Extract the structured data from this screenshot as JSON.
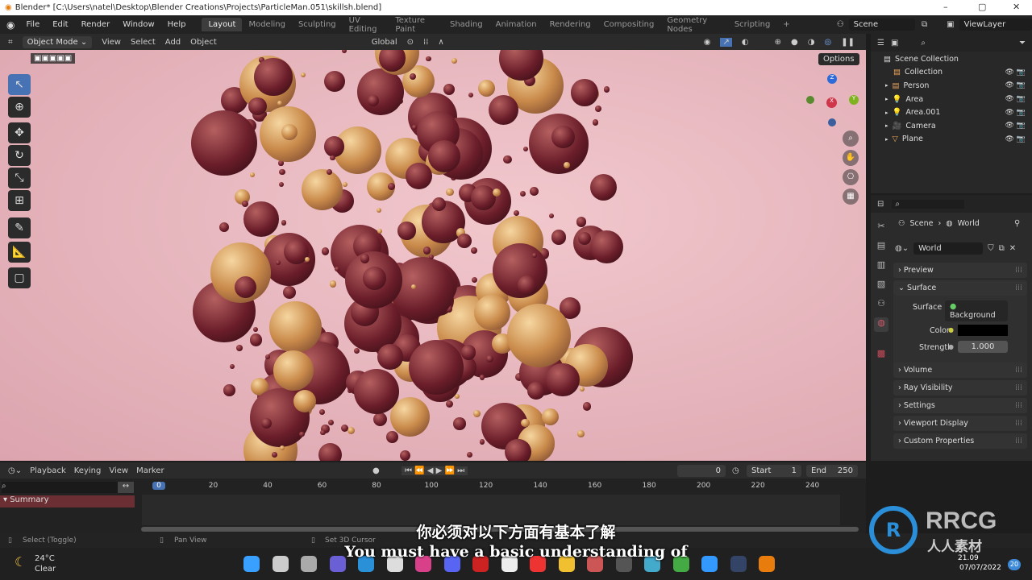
{
  "window": {
    "title": "Blender* [C:\\Users\\natel\\Desktop\\Blender Creations\\Projects\\ParticleMan.051\\skillsh.blend]",
    "minimize": "–",
    "maximize": "▢",
    "close": "✕"
  },
  "menus": [
    "File",
    "Edit",
    "Render",
    "Window",
    "Help"
  ],
  "workspaces": [
    "Layout",
    "Modeling",
    "Sculpting",
    "UV Editing",
    "Texture Paint",
    "Shading",
    "Animation",
    "Rendering",
    "Compositing",
    "Geometry Nodes",
    "Scripting",
    "+"
  ],
  "active_workspace": "Layout",
  "scene": {
    "name": "Scene",
    "view_layer": "ViewLayer"
  },
  "viewport_header": {
    "mode": "Object Mode",
    "menus": [
      "View",
      "Select",
      "Add",
      "Object"
    ],
    "orientation": "Global",
    "options": "Options"
  },
  "gizmo": {
    "z": "Z",
    "x": "X",
    "y": "Y"
  },
  "outliner": {
    "root": "Scene Collection",
    "items": [
      {
        "name": "Collection",
        "icon": "collection-icon"
      },
      {
        "name": "Person",
        "icon": "collection-icon"
      },
      {
        "name": "Area",
        "icon": "light-icon"
      },
      {
        "name": "Area.001",
        "icon": "light-icon"
      },
      {
        "name": "Camera",
        "icon": "camera-icon"
      },
      {
        "name": "Plane",
        "icon": "mesh-icon"
      }
    ]
  },
  "properties": {
    "breadcrumb": [
      "Scene",
      "World"
    ],
    "world_name": "World",
    "panels_top": [
      "Preview",
      "Surface"
    ],
    "surface_label": "Surface",
    "surface_value": "Background",
    "color_label": "Color",
    "color_value": "#000000",
    "strength_label": "Strength",
    "strength_value": "1.000",
    "panels_bottom": [
      "Volume",
      "Ray Visibility",
      "Settings",
      "Viewport Display",
      "Custom Properties"
    ]
  },
  "timeline": {
    "menus": [
      "Playback",
      "Keying",
      "View",
      "Marker"
    ],
    "current_frame": "0",
    "start_label": "Start",
    "start": "1",
    "end_label": "End",
    "end": "250",
    "ticks": [
      "0",
      "20",
      "40",
      "60",
      "80",
      "100",
      "120",
      "140",
      "160",
      "180",
      "200",
      "220",
      "240"
    ],
    "summary": "Summary"
  },
  "status": {
    "select": "Select (Toggle)",
    "pan": "Pan View",
    "cursor": "Set 3D Cursor"
  },
  "taskbar": {
    "temp": "24°C",
    "weather": "Clear",
    "time": "21.09",
    "date": "07/07/2022",
    "badge": "20"
  },
  "subtitles": {
    "zh": "你必须对以下方面有基本了解",
    "en": "You must have a basic understanding of"
  },
  "watermark": {
    "brand": "RRCG",
    "cn": "人人素材"
  }
}
